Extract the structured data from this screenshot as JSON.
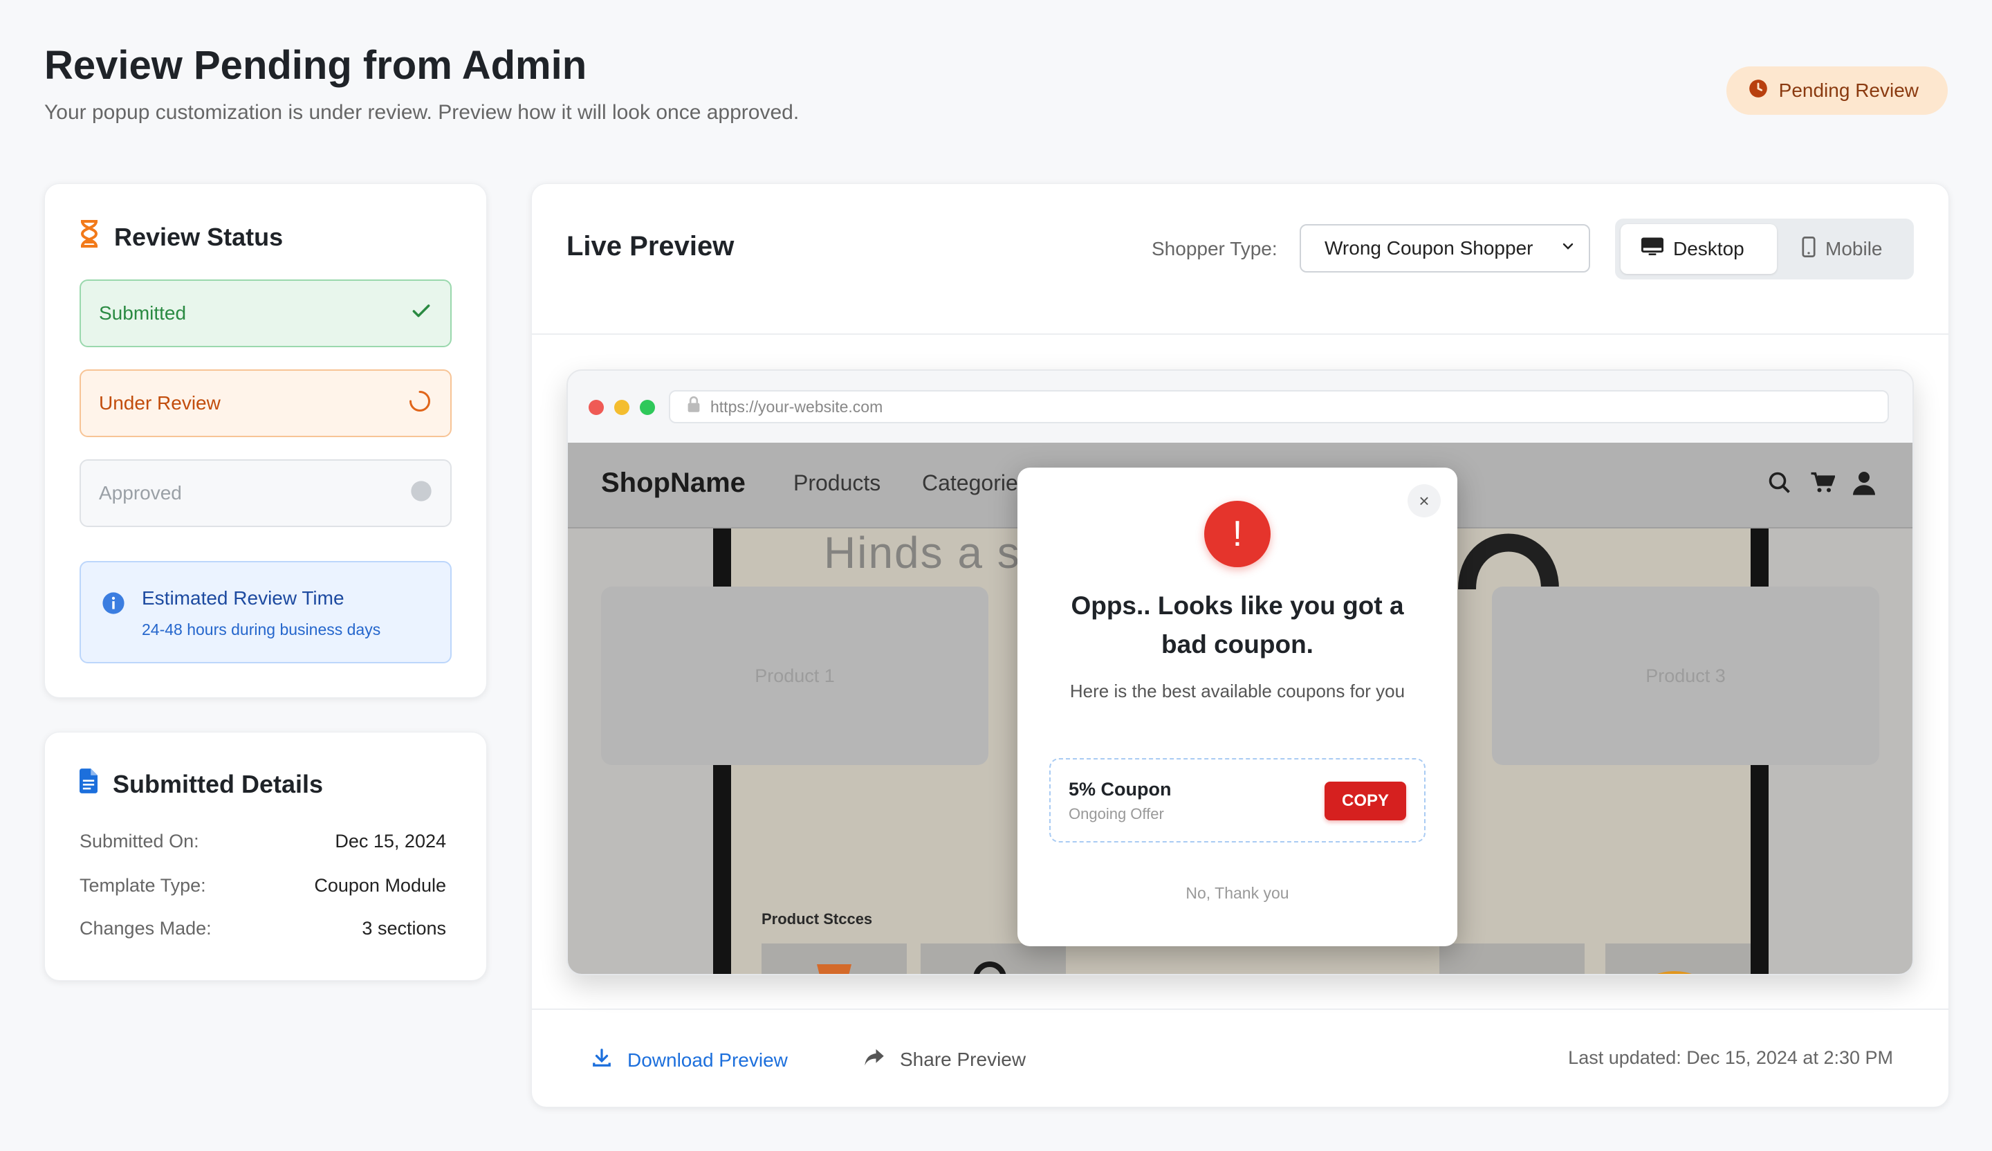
{
  "header": {
    "title": "Review Pending from Admin",
    "subtitle": "Your popup customization is under review. Preview how it will look once approved.",
    "badge": "Pending Review"
  },
  "status_card": {
    "title": "Review Status",
    "steps": [
      {
        "label": "Submitted",
        "state": "done"
      },
      {
        "label": "Under Review",
        "state": "in-progress"
      },
      {
        "label": "Approved",
        "state": "pending"
      }
    ],
    "estimate": {
      "title": "Estimated Review Time",
      "detail": "24-48 hours during business days"
    }
  },
  "details_card": {
    "title": "Submitted Details",
    "rows": [
      {
        "label": "Submitted On:",
        "value": "Dec 15, 2024"
      },
      {
        "label": "Template Type:",
        "value": "Coupon Module"
      },
      {
        "label": "Changes Made:",
        "value": "3 sections"
      }
    ]
  },
  "preview": {
    "title": "Live Preview",
    "shopper_label": "Shopper Type:",
    "shopper_value": "Wrong Coupon Shopper",
    "devices": {
      "desktop": "Desktop",
      "mobile": "Mobile",
      "selected": "Desktop"
    },
    "browser": {
      "url": "https://your-website.com"
    },
    "site": {
      "shop_name": "ShopName",
      "nav": [
        "Products",
        "Categorie"
      ],
      "hero_text": "Hinds a st",
      "products": [
        "Product 1",
        "Product 3"
      ],
      "stores_label": "Product Stcces"
    },
    "popup": {
      "icon": "!",
      "title": "Opps.. Looks like you got a bad coupon.",
      "subtitle": "Here is the best available coupons for you",
      "coupon_name": "5% Coupon",
      "coupon_sub": "Ongoing Offer",
      "copy_label": "COPY",
      "dismiss": "No, Thank you",
      "close": "×"
    },
    "footer": {
      "download": "Download Preview",
      "share": "Share Preview",
      "last_updated": "Last updated: Dec 15, 2024 at 2:30 PM"
    }
  },
  "colors": {
    "accent_blue": "#1c6fdc",
    "success_green": "#2a8a42",
    "warning_orange": "#c24d0c",
    "danger_red": "#d6201f"
  }
}
